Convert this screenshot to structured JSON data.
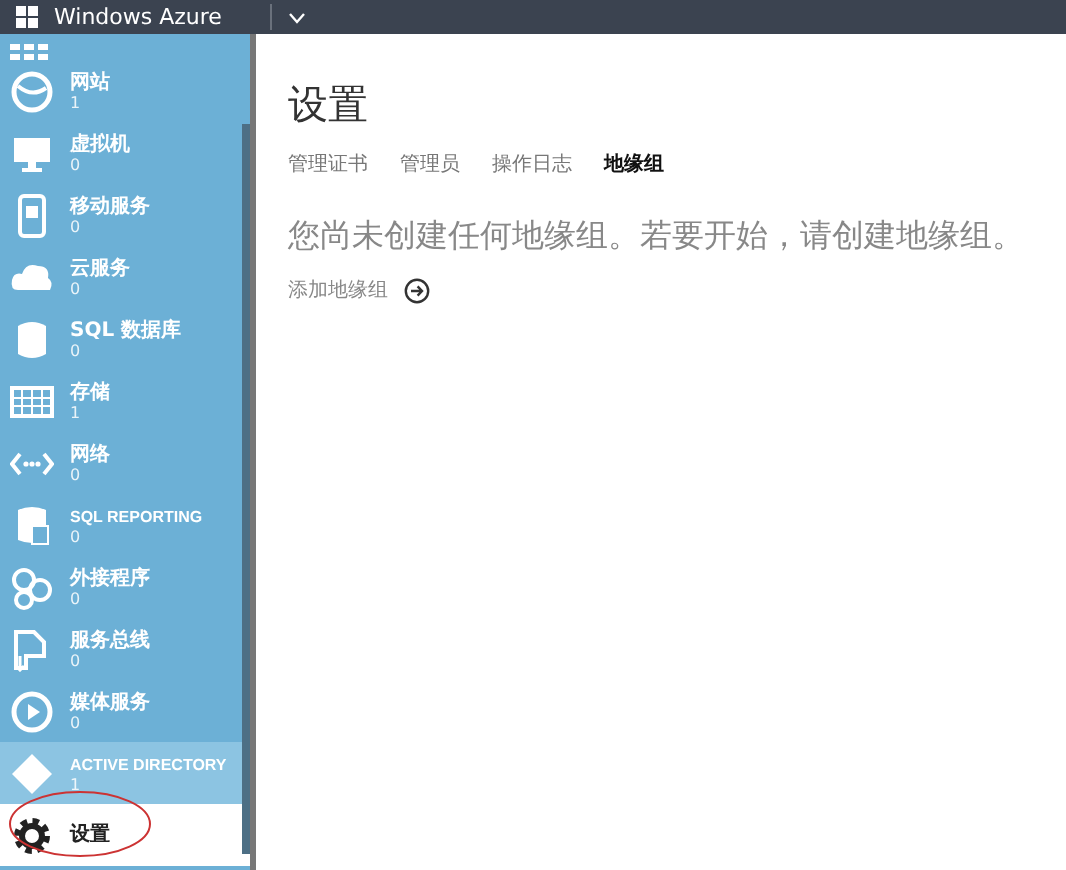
{
  "header": {
    "brand": "Windows Azure"
  },
  "sidebar": {
    "items": [
      {
        "label": "网站",
        "count": "1",
        "selected": false,
        "highlighted": false
      },
      {
        "label": "虚拟机",
        "count": "0",
        "selected": false,
        "highlighted": false
      },
      {
        "label": "移动服务",
        "count": "0",
        "selected": false,
        "highlighted": false
      },
      {
        "label": "云服务",
        "count": "0",
        "selected": false,
        "highlighted": false
      },
      {
        "label": "SQL 数据库",
        "count": "0",
        "selected": false,
        "highlighted": false
      },
      {
        "label": "存储",
        "count": "1",
        "selected": false,
        "highlighted": false
      },
      {
        "label": "网络",
        "count": "0",
        "selected": false,
        "highlighted": false
      },
      {
        "label": "SQL REPORTING",
        "count": "0",
        "selected": false,
        "highlighted": false
      },
      {
        "label": "外接程序",
        "count": "0",
        "selected": false,
        "highlighted": false
      },
      {
        "label": "服务总线",
        "count": "0",
        "selected": false,
        "highlighted": false
      },
      {
        "label": "媒体服务",
        "count": "0",
        "selected": false,
        "highlighted": false
      },
      {
        "label": "ACTIVE DIRECTORY",
        "count": "1",
        "selected": false,
        "highlighted": true
      },
      {
        "label": "设置",
        "selected": true,
        "highlighted": false
      }
    ]
  },
  "main": {
    "title": "设置",
    "tabs": [
      {
        "label": "管理证书",
        "selected": false
      },
      {
        "label": "管理员",
        "selected": false
      },
      {
        "label": "操作日志",
        "selected": false
      },
      {
        "label": "地缘组",
        "selected": true
      }
    ],
    "message": "您尚未创建任何地缘组。若要开始，请创建地缘组。",
    "action": "添加地缘组"
  }
}
